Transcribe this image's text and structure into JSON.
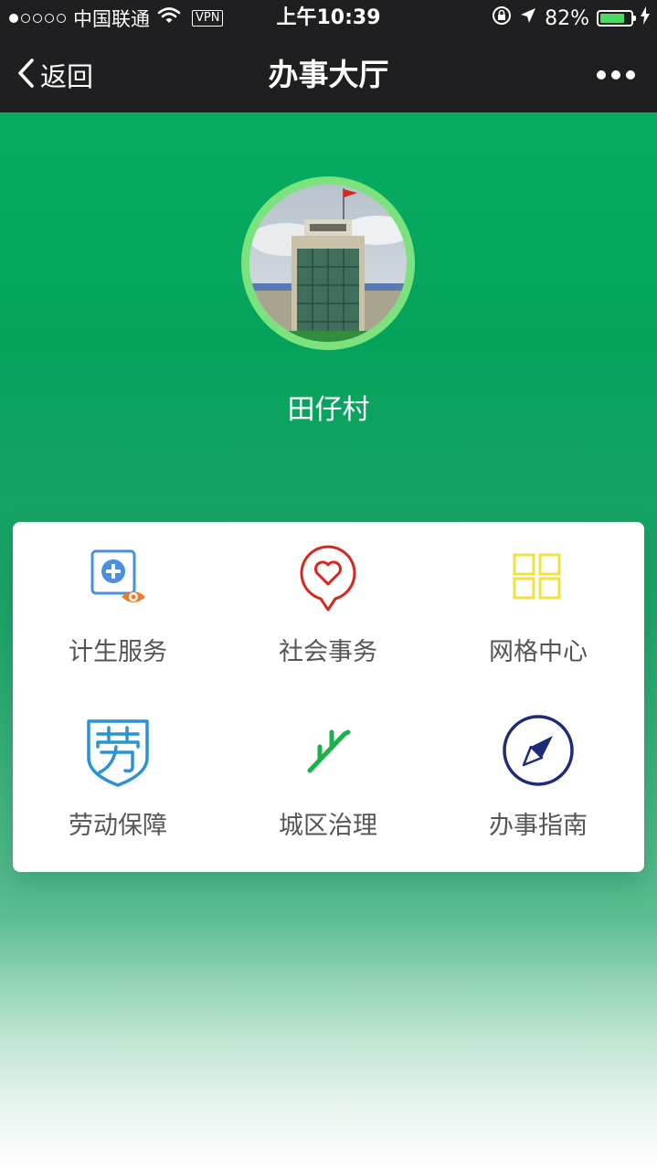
{
  "status_bar": {
    "carrier": "中国联通",
    "vpn": "VPN",
    "time": "上午10:39",
    "battery": "82%",
    "battery_level": 0.82,
    "signal_bars_filled": 1,
    "signal_bars_total": 5
  },
  "nav": {
    "back_label": "返回",
    "title": "办事大厅"
  },
  "profile": {
    "name": "田仔村"
  },
  "grid": {
    "items": [
      {
        "label": "计生服务",
        "icon": "medical-eye-icon",
        "color": "#4a8fe0",
        "accent": "#f07a2a"
      },
      {
        "label": "社会事务",
        "icon": "heart-bubble-icon",
        "color": "#d9271c"
      },
      {
        "label": "网格中心",
        "icon": "grid-icon",
        "color": "#f2e23c"
      },
      {
        "label": "劳动保障",
        "icon": "labor-shield-icon",
        "color": "#2a93d5"
      },
      {
        "label": "城区治理",
        "icon": "branch-icon",
        "color": "#1bb24b"
      },
      {
        "label": "办事指南",
        "icon": "compass-icon",
        "color": "#1e2a7a"
      }
    ]
  },
  "colors": {
    "header_bg": "#1f1f21",
    "brand_green": "#07ad60",
    "avatar_ring": "#7be27e"
  }
}
